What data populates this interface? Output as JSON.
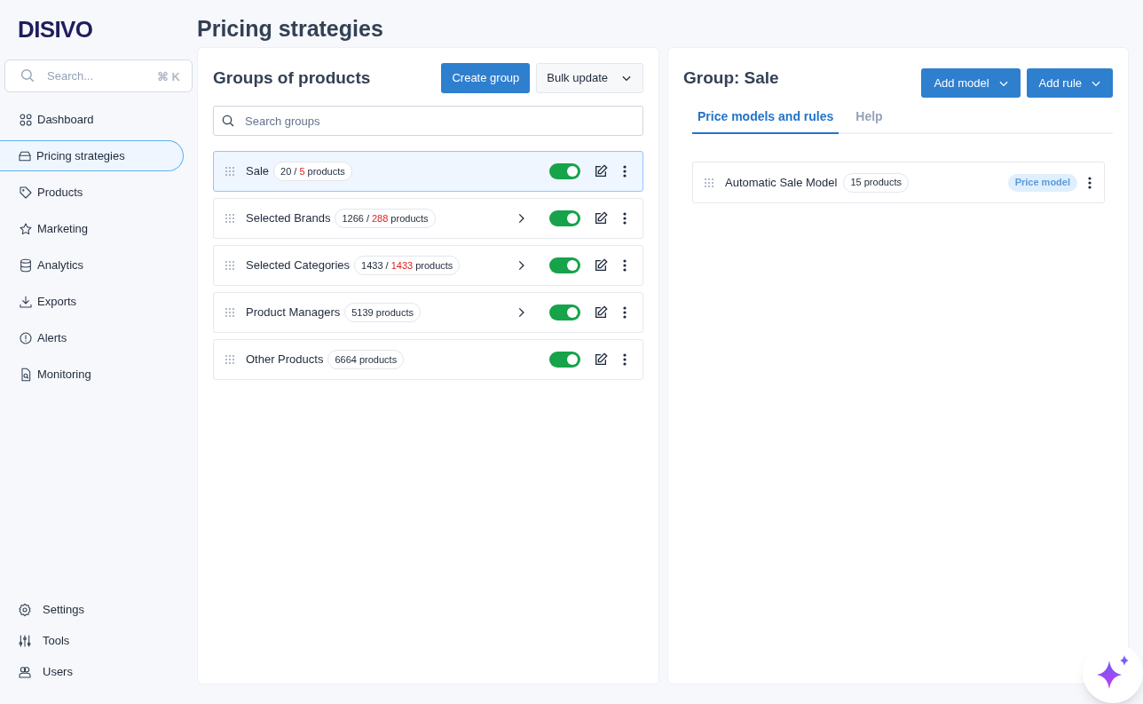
{
  "logo": "DISIVO",
  "search": {
    "placeholder": "Search...",
    "shortcut": "⌘ K"
  },
  "nav": [
    {
      "label": "Dashboard",
      "selected": false
    },
    {
      "label": "Pricing strategies",
      "selected": true
    },
    {
      "label": "Products",
      "selected": false
    },
    {
      "label": "Marketing",
      "selected": false
    },
    {
      "label": "Analytics",
      "selected": false
    },
    {
      "label": "Exports",
      "selected": false
    },
    {
      "label": "Alerts",
      "selected": false
    },
    {
      "label": "Monitoring",
      "selected": false
    }
  ],
  "nav_bottom": [
    {
      "label": "Settings"
    },
    {
      "label": "Tools"
    },
    {
      "label": "Users"
    }
  ],
  "page_title": "Pricing strategies",
  "groups_panel": {
    "title": "Groups of products",
    "create_button": "Create group",
    "bulk_button": "Bulk update",
    "search_placeholder": "Search groups",
    "groups": [
      {
        "name": "Sale",
        "count": "20 /",
        "filtered": "5",
        "unit": "products",
        "expandable": false,
        "on": true,
        "selected": true
      },
      {
        "name": "Selected Brands",
        "count": "1266 /",
        "filtered": "288",
        "unit": "products",
        "expandable": true,
        "on": true,
        "selected": false
      },
      {
        "name": "Selected Categories",
        "count": "1433 /",
        "filtered": "1433",
        "unit": "products",
        "expandable": true,
        "on": true,
        "selected": false
      },
      {
        "name": "Product Managers",
        "count": "5139 products",
        "expandable": true,
        "on": true,
        "selected": false
      },
      {
        "name": "Other Products",
        "count": "6664 products",
        "expandable": false,
        "on": true,
        "selected": false
      }
    ]
  },
  "detail_panel": {
    "title": "Group: Sale",
    "buttons": [
      "Add model",
      "Add rule"
    ],
    "tabs": [
      {
        "label": "Price models and rules",
        "selected": true
      },
      {
        "label": "Help",
        "selected": false
      }
    ],
    "models": [
      {
        "name": "Automatic Sale Model",
        "count": "15 products",
        "tag": "Price model"
      }
    ]
  }
}
